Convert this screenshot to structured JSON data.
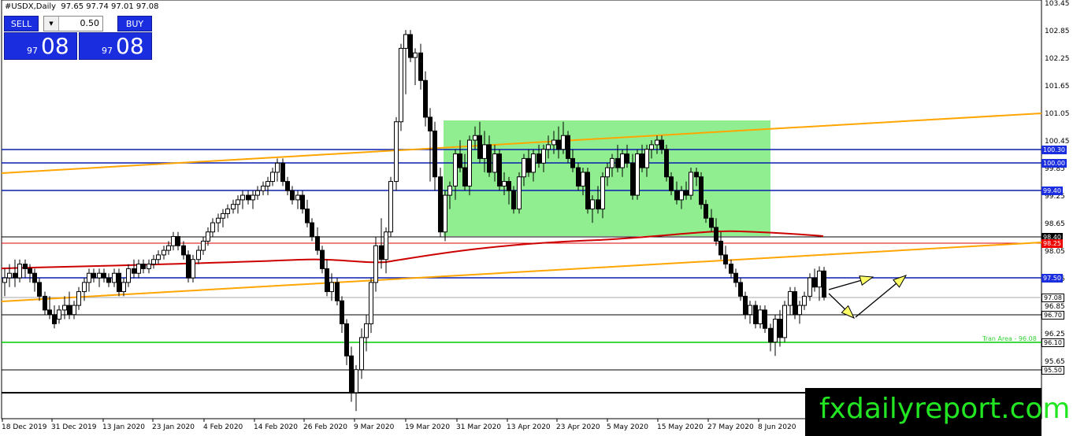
{
  "header": {
    "title": "#USDX,Daily  97.65 97.74 97.01 97.08"
  },
  "trade_panel": {
    "sell_label": "SELL",
    "buy_label": "BUY",
    "lot_size": "0.50",
    "sell_price_small": "97",
    "sell_price_big": "08",
    "buy_price_small": "97",
    "buy_price_big": "08"
  },
  "price_axis": {
    "ticks": [
      "103.45",
      "102.85",
      "102.25",
      "101.65",
      "101.05",
      "100.45",
      "99.85",
      "99.25",
      "98.65",
      "98.05",
      "97.45",
      "96.85",
      "96.25",
      "95.65"
    ],
    "tags": [
      {
        "label": "100.30",
        "style": "blue"
      },
      {
        "label": "100.00",
        "style": "blue"
      },
      {
        "label": "99.40",
        "style": "blue"
      },
      {
        "label": "98.40",
        "style": "black"
      },
      {
        "label": "98.25",
        "style": "red"
      },
      {
        "label": "97.50",
        "style": "blue"
      },
      {
        "label": "97.08",
        "style": "black"
      },
      {
        "label": "96.70",
        "style": "black"
      },
      {
        "label": "96.10",
        "style": "black"
      },
      {
        "label": "95.50",
        "style": "black"
      }
    ]
  },
  "date_axis": [
    "18 Dec 2019",
    "31 Dec 2019",
    "13 Jan 2020",
    "23 Jan 2020",
    "4 Feb 2020",
    "14 Feb 2020",
    "26 Feb 2020",
    "9 Mar 2020",
    "19 Mar 2020",
    "31 Mar 2020",
    "13 Apr 2020",
    "23 Apr 2020",
    "5 May 2020",
    "15 May 2020",
    "27 May 2020",
    "8 Jun 2020"
  ],
  "zone_label": "Tran Area - 96.08",
  "brand": "fxdailyreport.com",
  "colors": {
    "accent": "#1a2ee0",
    "range_box": "#90ee90",
    "trend_line": "#ffa500",
    "ma_line": "#cc0000",
    "green_line": "#00cc00",
    "brand_text": "#22e622"
  },
  "chart_data": {
    "type": "candlestick",
    "title": "#USDX,Daily",
    "ohlc_last": {
      "open": 97.65,
      "high": 97.74,
      "low": 97.01,
      "close": 97.08
    },
    "horizontal_levels": [
      100.3,
      100.0,
      99.4,
      98.4,
      98.25,
      97.5,
      97.08,
      96.7,
      96.1,
      95.5
    ],
    "ylim": [
      95.3,
      103.5
    ]
  }
}
